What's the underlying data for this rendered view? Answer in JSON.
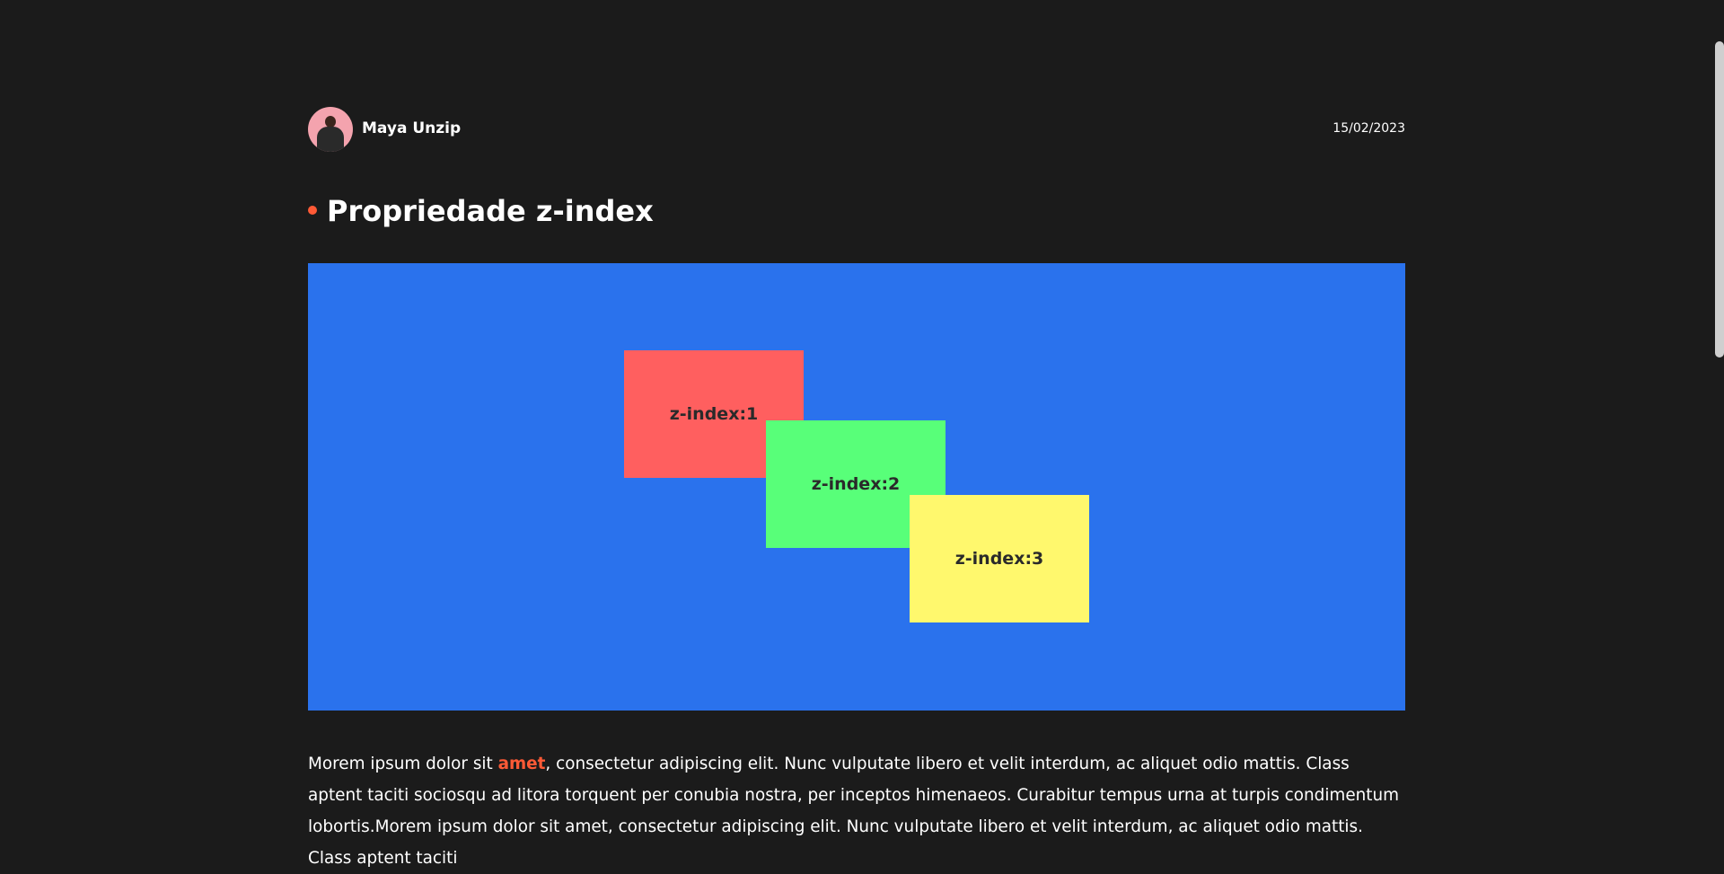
{
  "post": {
    "author": "Maya Unzip",
    "date": "15/02/2023",
    "title": "Propriedade z-index"
  },
  "demo": {
    "boxes": [
      {
        "label": "z-index:1",
        "color": "#ff5f5f"
      },
      {
        "label": "z-index:2",
        "color": "#58ff79"
      },
      {
        "label": "z-index:3",
        "color": "#fff86d"
      }
    ],
    "background": "#2a72ed"
  },
  "body": {
    "text_before": "Morem ipsum dolor sit ",
    "highlight": "amet",
    "text_after": ", consectetur adipiscing elit. Nunc vulputate libero et velit interdum, ac aliquet odio mattis. Class aptent taciti sociosqu ad litora torquent per conubia nostra, per inceptos himenaeos. Curabitur tempus urna at turpis condimentum lobortis.Morem ipsum dolor sit amet, consectetur adipiscing elit. Nunc vulputate libero et velit interdum, ac aliquet odio mattis. Class aptent taciti"
  },
  "colors": {
    "page_background": "#1b1b1b",
    "accent": "#ff5a36",
    "text": "#ffffff"
  },
  "icons": {
    "bullet": "dot-icon",
    "avatar": "avatar-photo"
  }
}
